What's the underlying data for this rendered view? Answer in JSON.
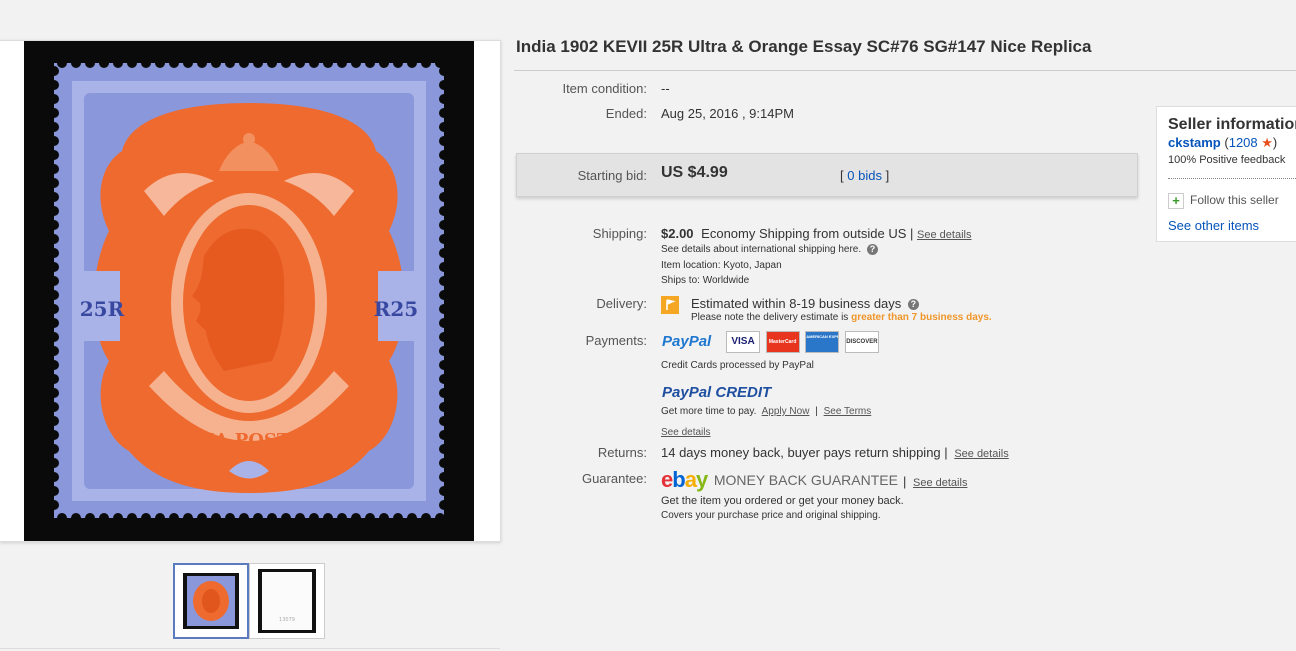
{
  "title": "India 1902 KEVII 25R Ultra & Orange Essay SC#76 SG#147 Nice Replica",
  "gallery": {
    "stamp_denomination": "25R",
    "stamp_caption": "INDIA POSTAGE",
    "stamp_denomination_right": "R25",
    "back_thumb_code": "13079"
  },
  "condition": {
    "label": "Item condition:",
    "value": "--"
  },
  "ended": {
    "label": "Ended:",
    "value": "Aug 25, 2016 , 9:14PM"
  },
  "bid": {
    "label": "Starting bid:",
    "price": "US $4.99",
    "open_bracket": "[",
    "bids_link": "0 bids",
    "close_bracket": "]"
  },
  "shipping": {
    "label": "Shipping:",
    "cost": "$2.00",
    "method": "Economy Shipping from outside US",
    "sep": "|",
    "see_details": "See details",
    "intl_note": "See details about international shipping here.",
    "location": "Item location:  Kyoto, Japan",
    "ships_to": "Ships to:  Worldwide"
  },
  "delivery": {
    "label": "Delivery:",
    "estimate": "Estimated within 8-19 business days",
    "note_prefix": "Please note the delivery estimate is ",
    "note_highlight": "greater than 7 business days."
  },
  "payments": {
    "label": "Payments:",
    "paypal": "PayPal",
    "cards": [
      "VISA",
      "MasterCard",
      "AMERICAN EXPRESS",
      "DISCOVER"
    ],
    "card_note": "Credit Cards processed by PayPal",
    "credit_logo": "PayPal CREDIT",
    "credit_text": "Get more time to pay.",
    "apply_now": "Apply Now",
    "sep": "|",
    "see_terms": "See Terms",
    "see_details": "See details"
  },
  "returns": {
    "label": "Returns:",
    "value": "14 days money back, buyer pays return shipping",
    "sep": "|",
    "see_details": "See details"
  },
  "guarantee": {
    "label": "Guarantee:",
    "ebay_letters": [
      "e",
      "b",
      "a",
      "y"
    ],
    "mbg": "MONEY BACK GUARANTEE",
    "sep": "|",
    "see_details": "See details",
    "line1": "Get the item you ordered or get your money back.",
    "line2": "Covers your purchase price and original shipping."
  },
  "seller": {
    "title": "Seller information",
    "name": "ckstamp",
    "paren_open": "(",
    "score": "1208",
    "star": "★",
    "paren_close": ")",
    "feedback": "100% Positive feedback",
    "plus": "+",
    "follow": "Follow this seller",
    "other_items": "See other items"
  },
  "colors": {
    "link": "#0654ba",
    "stamp_blue": "#8a98db",
    "stamp_orange": "#ee6a2f",
    "highlight": "#f0962a",
    "star": "#e8501c"
  }
}
